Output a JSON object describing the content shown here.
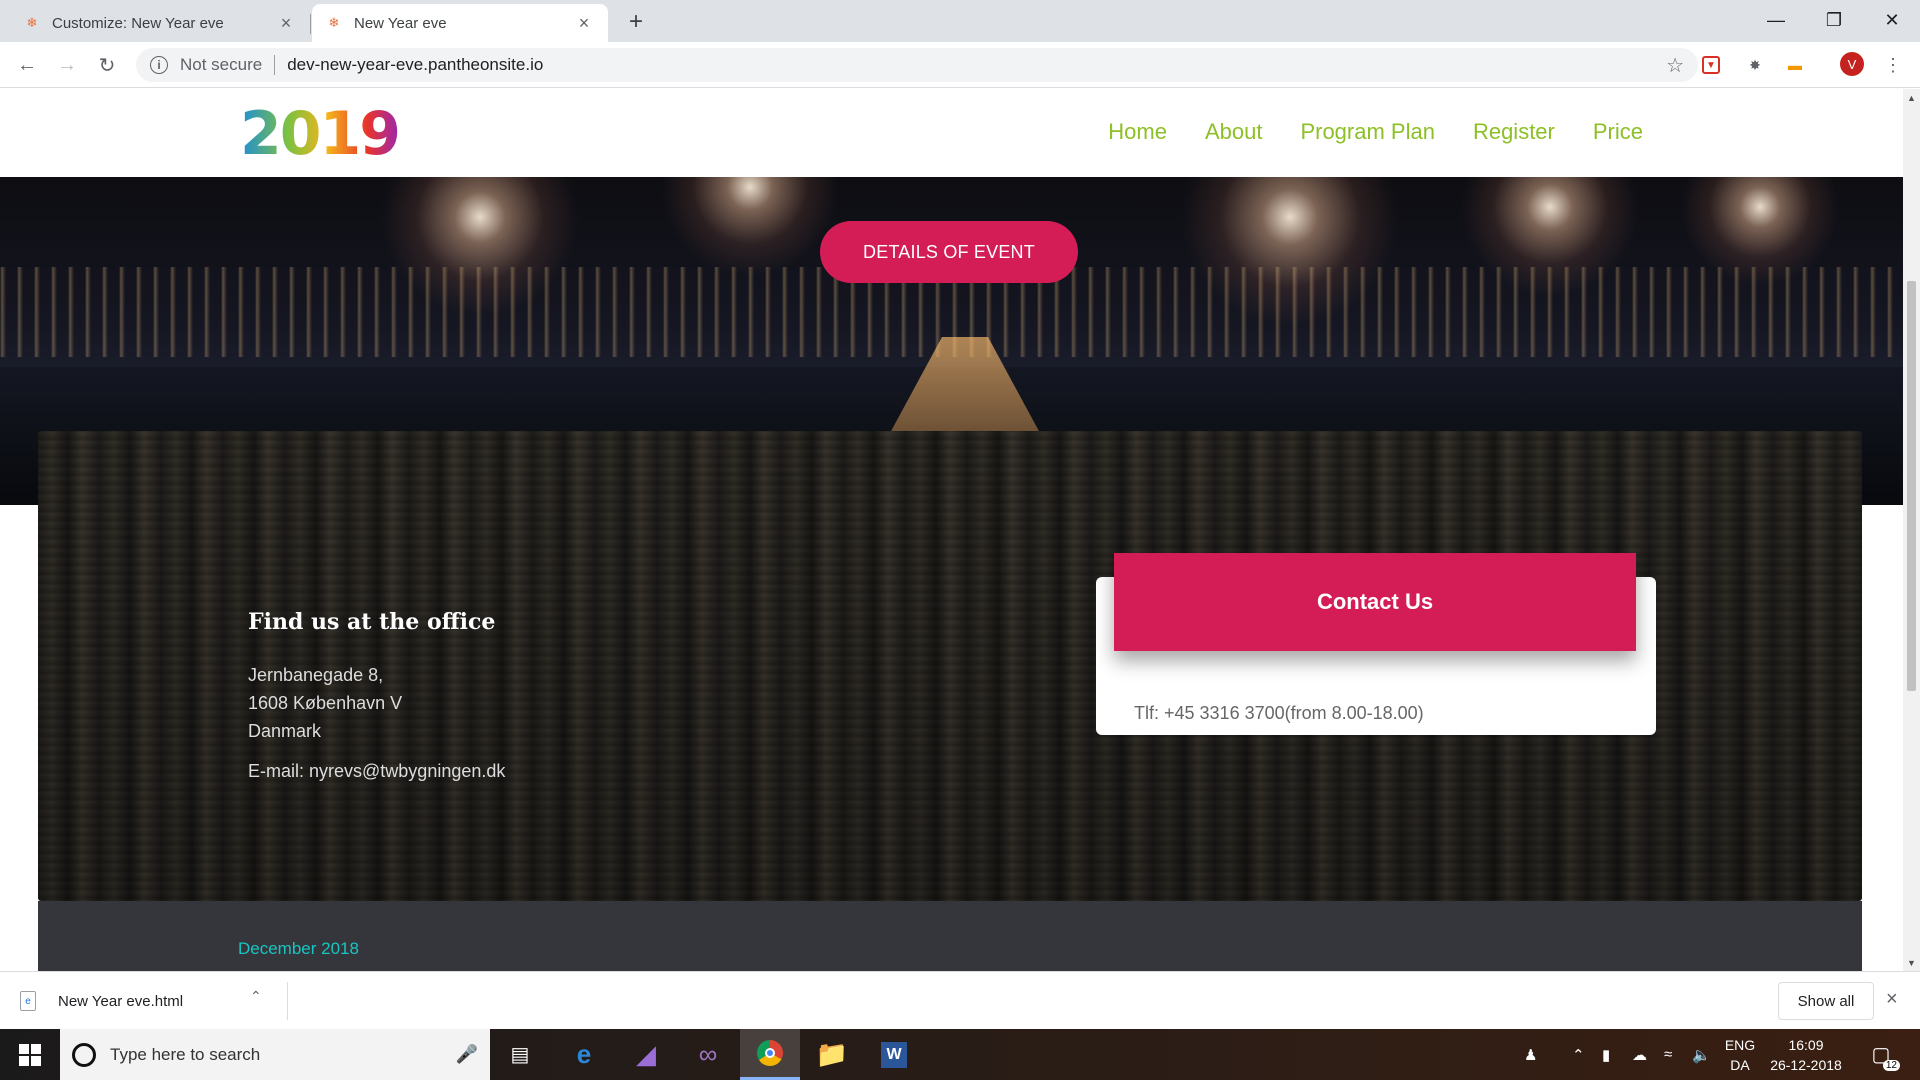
{
  "browser": {
    "tabs": [
      {
        "title": "Customize: New Year eve",
        "active": false
      },
      {
        "title": "New Year eve",
        "active": true
      }
    ],
    "security_label": "Not secure",
    "url": "dev-new-year-eve.pantheonsite.io",
    "profile_initial": "V"
  },
  "site": {
    "logo_text": "2019",
    "logo_colors": [
      "#1f8ed6",
      "#e8342b",
      "#7cc142",
      "#f4b41a"
    ],
    "nav": [
      "Home",
      "About",
      "Program Plan",
      "Register",
      "Price"
    ],
    "accent": "#d41d57",
    "nav_color": "#8dc026"
  },
  "hero": {
    "button_label": "DETAILS OF EVENT"
  },
  "contact": {
    "office_heading": "Find us at the office",
    "address_line1": "Jernbanegade 8,",
    "address_line2": "1608 København V",
    "address_line3": "Danmark",
    "email": "E-mail: nyrevs@twbygningen.dk",
    "card_title": "Contact Us",
    "phone": "Tlf: +45 3316 3700(from 8.00-18.00)"
  },
  "footer": {
    "date_label": "December 2018"
  },
  "downloads": {
    "file_name": "New Year eve.html",
    "show_all": "Show all"
  },
  "taskbar": {
    "search_placeholder": "Type here to search",
    "lang_top": "ENG",
    "lang_bottom": "DA",
    "time": "16:09",
    "date": "26-12-2018",
    "notification_count": "12"
  }
}
